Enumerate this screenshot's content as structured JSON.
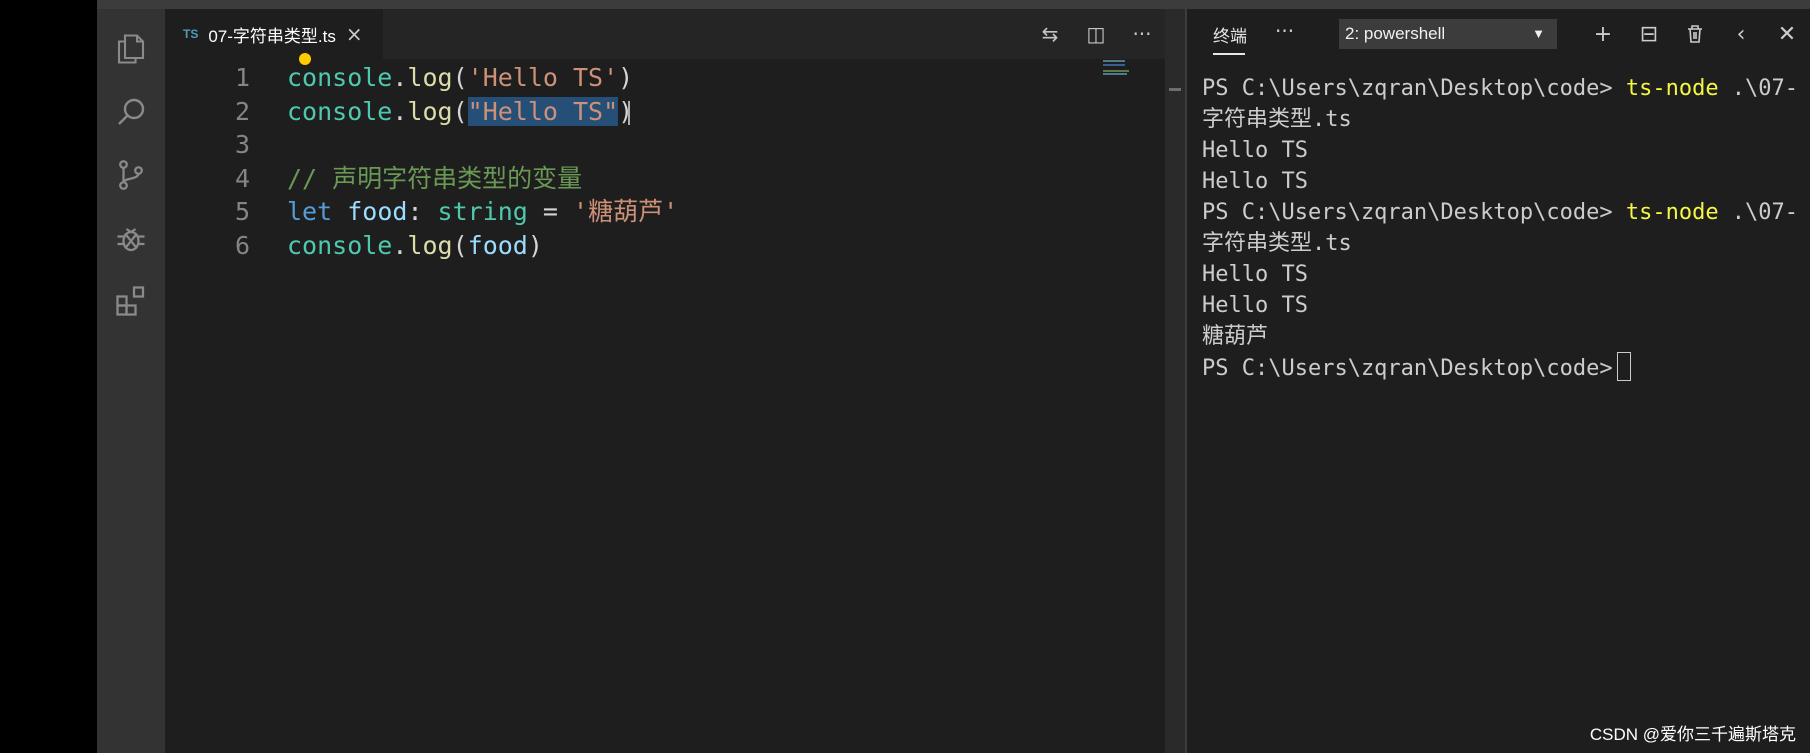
{
  "activity_bar": {
    "icons": [
      "files-icon",
      "search-icon",
      "source-control-icon",
      "debug-icon",
      "extensions-icon"
    ]
  },
  "editor": {
    "tab": {
      "badge": "TS",
      "filename": "07-字符串类型.ts",
      "close": "×"
    },
    "actions": {
      "compare": "⇆",
      "split": "◫",
      "more": "···"
    },
    "lines": [
      {
        "number": "1",
        "tokens": [
          {
            "text": "console",
            "cls": "t-fn"
          },
          {
            "text": ".",
            "cls": ""
          },
          {
            "text": "log",
            "cls": "t-m"
          },
          {
            "text": "(",
            "cls": ""
          },
          {
            "text": "'Hello TS'",
            "cls": "t-s"
          },
          {
            "text": ")",
            "cls": ""
          }
        ]
      },
      {
        "number": "2",
        "tokens": [
          {
            "text": "console",
            "cls": "t-fn"
          },
          {
            "text": ".",
            "cls": ""
          },
          {
            "text": "log",
            "cls": "t-m"
          },
          {
            "text": "(",
            "cls": ""
          },
          {
            "text": "\"Hello TS\"",
            "cls": "t-s sel"
          },
          {
            "text": ")",
            "cls": ""
          }
        ]
      },
      {
        "number": "3",
        "tokens": []
      },
      {
        "number": "4",
        "tokens": [
          {
            "text": "// 声明字符串类型的变量",
            "cls": "t-c"
          }
        ]
      },
      {
        "number": "5",
        "tokens": [
          {
            "text": "let",
            "cls": "t-k"
          },
          {
            "text": " ",
            "cls": ""
          },
          {
            "text": "food",
            "cls": "t-v"
          },
          {
            "text": ": ",
            "cls": ""
          },
          {
            "text": "string",
            "cls": "t-fn"
          },
          {
            "text": " = ",
            "cls": ""
          },
          {
            "text": "'糖葫芦'",
            "cls": "t-s"
          }
        ]
      },
      {
        "number": "6",
        "tokens": [
          {
            "text": "console",
            "cls": "t-fn"
          },
          {
            "text": ".",
            "cls": ""
          },
          {
            "text": "log",
            "cls": "t-m"
          },
          {
            "text": "(",
            "cls": ""
          },
          {
            "text": "food",
            "cls": "t-v"
          },
          {
            "text": ")",
            "cls": ""
          }
        ]
      }
    ]
  },
  "panel": {
    "tab_label": "终端",
    "more": "···",
    "selected_terminal": "2: powershell",
    "actions": {
      "add": "+",
      "split": "⊟",
      "kill": "🗑",
      "prev": "‹",
      "close": "✕"
    },
    "output": [
      {
        "text": "PS C:\\Users\\zqran\\Desktop\\code> ",
        "cmd": "ts-node",
        "rest": " .\\07-"
      },
      {
        "text": "字符串类型.ts",
        "cmd": "",
        "rest": ""
      },
      {
        "text": "Hello TS",
        "cmd": "",
        "rest": ""
      },
      {
        "text": "Hello TS",
        "cmd": "",
        "rest": ""
      },
      {
        "text": "PS C:\\Users\\zqran\\Desktop\\code> ",
        "cmd": "ts-node",
        "rest": " .\\07-"
      },
      {
        "text": "字符串类型.ts",
        "cmd": "",
        "rest": ""
      },
      {
        "text": "Hello TS",
        "cmd": "",
        "rest": ""
      },
      {
        "text": "Hello TS",
        "cmd": "",
        "rest": ""
      },
      {
        "text": "糖葫芦",
        "cmd": "",
        "rest": ""
      },
      {
        "text": "PS C:\\Users\\zqran\\Desktop\\code>",
        "cmd": "",
        "rest": "",
        "cursor": true
      }
    ]
  },
  "watermark": "CSDN @爱你三千遍斯塔克",
  "colors": {
    "editor_bg": "#1e1e1e",
    "activity_bg": "#333333",
    "selection": "#264f78",
    "command": "#f5f543"
  }
}
